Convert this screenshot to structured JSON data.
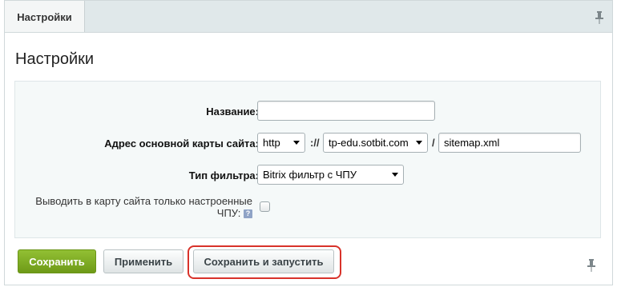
{
  "tab": {
    "label": "Настройки"
  },
  "panel": {
    "title": "Настройки"
  },
  "form": {
    "name_label": "Название:",
    "name_value": "",
    "sitemap_label": "Адрес основной карты сайта:",
    "protocol_value": "http",
    "separator_scheme": "://",
    "domain_value": "tp-edu.sotbit.com",
    "separator_path": "/",
    "filename_value": "sitemap.xml",
    "filter_type_label": "Тип фильтра:",
    "filter_type_value": "Bitrix фильтр с ЧПУ",
    "only_sef_label_line1": "Выводить в карту сайта только настроенные",
    "only_sef_label_line2": "ЧПУ:",
    "help_icon_glyph": "?",
    "only_sef_checked": false
  },
  "buttons": {
    "save": "Сохранить",
    "apply": "Применить",
    "save_and_run": "Сохранить и запустить"
  },
  "colors": {
    "accent_green": "#7aa81f",
    "highlight_red": "#d8322a"
  }
}
